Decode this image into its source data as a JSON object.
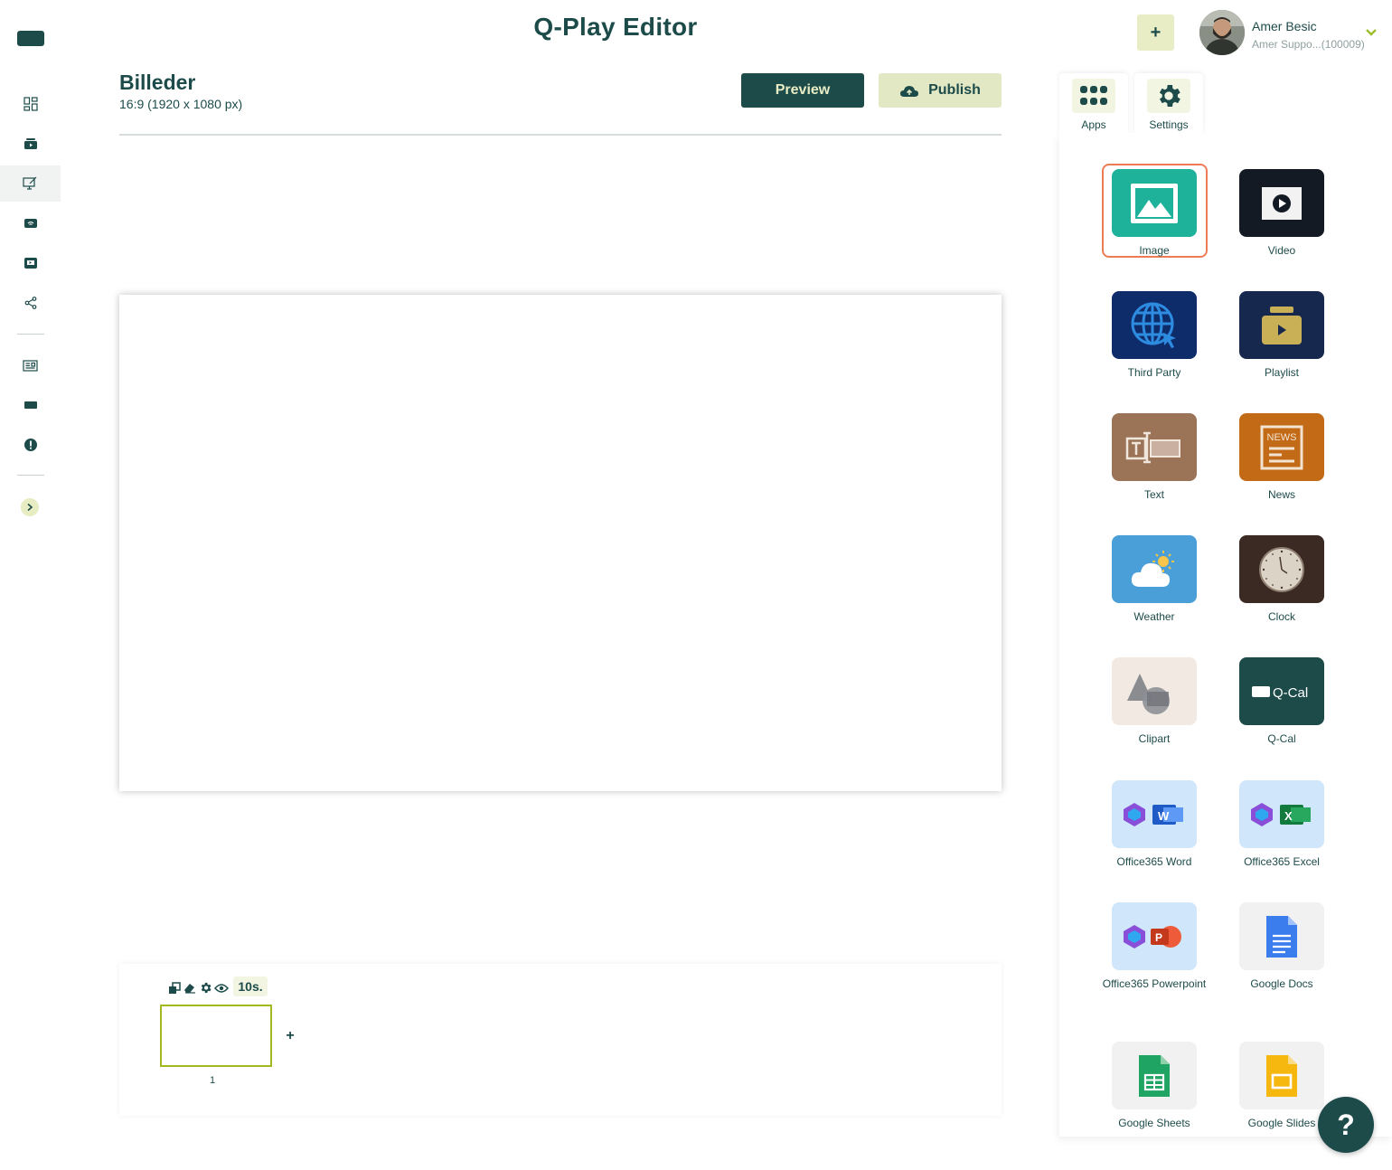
{
  "header": {
    "title": "Q-Play Editor",
    "add_label": "+",
    "user": {
      "name": "Amer Besic",
      "subtitle": "Amer Suppo...(100009)"
    }
  },
  "page": {
    "title": "Billeder",
    "resolution": "16:9 (1920 x 1080 px)",
    "preview_label": "Preview",
    "publish_label": "Publish"
  },
  "timeline": {
    "duration": "10s.",
    "add_label": "+",
    "slides": [
      {
        "number": "1"
      }
    ]
  },
  "panel": {
    "tabs": [
      {
        "label": "Apps",
        "icon": "apps-grid-icon"
      },
      {
        "label": "Settings",
        "icon": "gear-icon"
      }
    ],
    "apps": [
      {
        "label": "Image",
        "icon": "image-icon",
        "color": "#1fb29a",
        "selected": true
      },
      {
        "label": "Video",
        "icon": "video-icon",
        "color": "#141a24"
      },
      {
        "label": "Third Party",
        "icon": "globe-icon",
        "color": "#0e2b6a"
      },
      {
        "label": "Playlist",
        "icon": "playlist-icon",
        "color": "#16284d"
      },
      {
        "label": "Text",
        "icon": "text-icon",
        "color": "#9b7458"
      },
      {
        "label": "News",
        "icon": "news-icon",
        "color": "#c26a16"
      },
      {
        "label": "Weather",
        "icon": "weather-icon",
        "color": "#4b9fd8"
      },
      {
        "label": "Clock",
        "icon": "clock-icon",
        "color": "#3a2a23"
      },
      {
        "label": "Clipart",
        "icon": "clipart-icon",
        "color": "#f2e9e2"
      },
      {
        "label": "Q-Cal",
        "icon": "qcal-icon",
        "color": "#1d4b4a",
        "tile_text": "Q-Cal"
      },
      {
        "label": "Office365 Word",
        "icon": "office-word-icon",
        "color": "#cfe6fb"
      },
      {
        "label": "Office365 Excel",
        "icon": "office-excel-icon",
        "color": "#cfe6fb"
      },
      {
        "label": "Office365 Powerpoint",
        "icon": "office-powerpoint-icon",
        "color": "#cfe6fb"
      },
      {
        "label": "Google Docs",
        "icon": "google-docs-icon",
        "color": "#f1f1f1"
      },
      {
        "label": "Google Sheets",
        "icon": "google-sheets-icon",
        "color": "#f1f1f1"
      },
      {
        "label": "Google Slides",
        "icon": "google-slides-icon",
        "color": "#f1f1f1"
      }
    ]
  },
  "help": {
    "label": "?"
  },
  "colors": {
    "primary": "#1d4b4a",
    "accent": "#e8edc6",
    "selection": "#ee7b57",
    "slide_border": "#a3b71f"
  }
}
